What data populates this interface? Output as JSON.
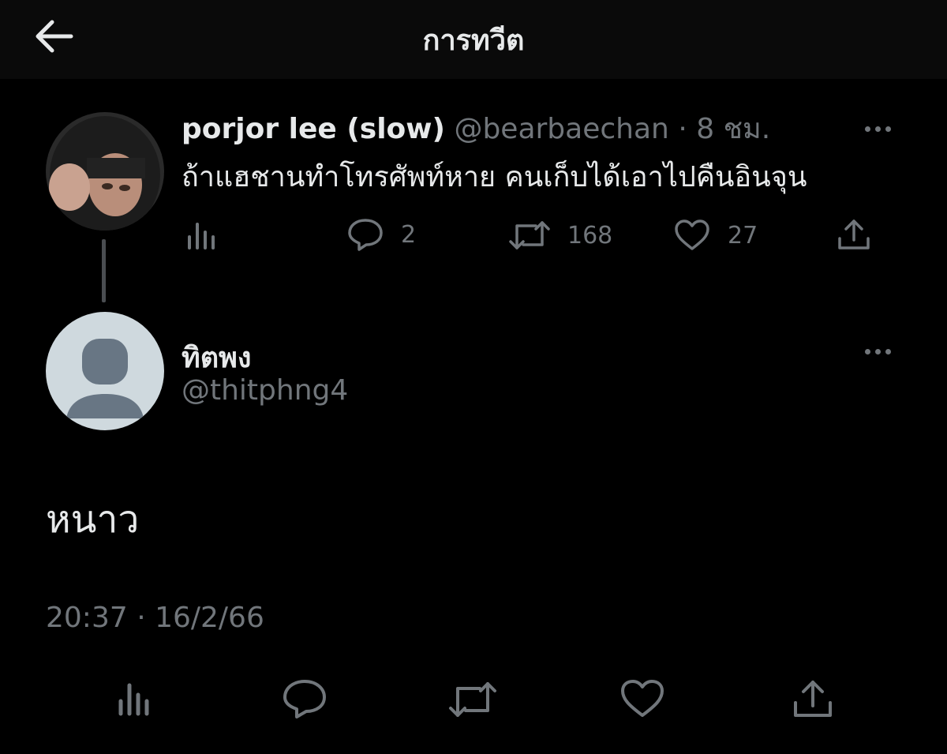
{
  "header": {
    "title": "การทวีต",
    "back_icon": "arrow-left-icon"
  },
  "parent_tweet": {
    "author_name": "porjor lee (slow)",
    "author_handle": "@bearbaechan",
    "separator": "·",
    "time_ago": "8 ชม.",
    "text": "ถ้าแฮชานทำโทรศัพท์หาย คนเก็บได้เอาไปคืนอินจุน",
    "stats": {
      "replies": "2",
      "retweets": "168",
      "likes": "27"
    }
  },
  "reply_tweet": {
    "author_name": "ทิตพง",
    "author_handle": "@thitphng4",
    "text": "หนาว",
    "timestamp": "20:37 · 16/2/66"
  },
  "colors": {
    "background": "#000000",
    "text": "#e7e9ea",
    "dim": "#71767b",
    "thread_line": "#4a4d51",
    "default_avatar": "#cfd9de"
  }
}
